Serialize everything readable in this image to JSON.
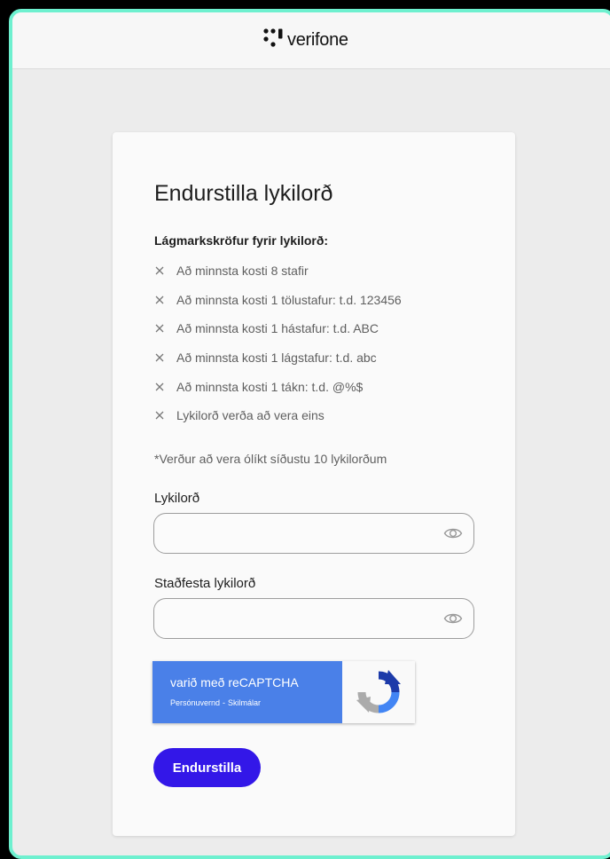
{
  "brand": {
    "name": "verifone",
    "frame_color": "#6ef0cf"
  },
  "form": {
    "title": "Endurstilla lykilorð",
    "requirements_heading": "Lágmarkskröfur fyrir lykilorð:",
    "requirements": [
      {
        "icon": "x-icon",
        "met": false,
        "text": "Að minnsta kosti 8 stafir"
      },
      {
        "icon": "x-icon",
        "met": false,
        "text": "Að minnsta kosti 1 tölustafur: t.d. 123456"
      },
      {
        "icon": "x-icon",
        "met": false,
        "text": "Að minnsta kosti 1 hástafur: t.d. ABC"
      },
      {
        "icon": "x-icon",
        "met": false,
        "text": "Að minnsta kosti 1 lágstafur: t.d. abc"
      },
      {
        "icon": "x-icon",
        "met": false,
        "text": "Að minnsta kosti 1 tákn: t.d. @%$"
      },
      {
        "icon": "x-icon",
        "met": false,
        "text": "Lykilorð verða að vera eins"
      }
    ],
    "history_note": "*Verður að vera ólíkt síðustu 10 lykilorðum",
    "password_label": "Lykilorð",
    "password_value": "",
    "confirm_label": "Staðfesta lykilorð",
    "confirm_value": "",
    "visibility_icon": "eye-icon",
    "submit_label": "Endurstilla",
    "submit_color": "#3317e8"
  },
  "recaptcha": {
    "title": "varið með reCAPTCHA",
    "privacy_link": "Persónuvernd",
    "separator": "-",
    "terms_link": "Skilmálar",
    "color": "#4a80e8"
  }
}
